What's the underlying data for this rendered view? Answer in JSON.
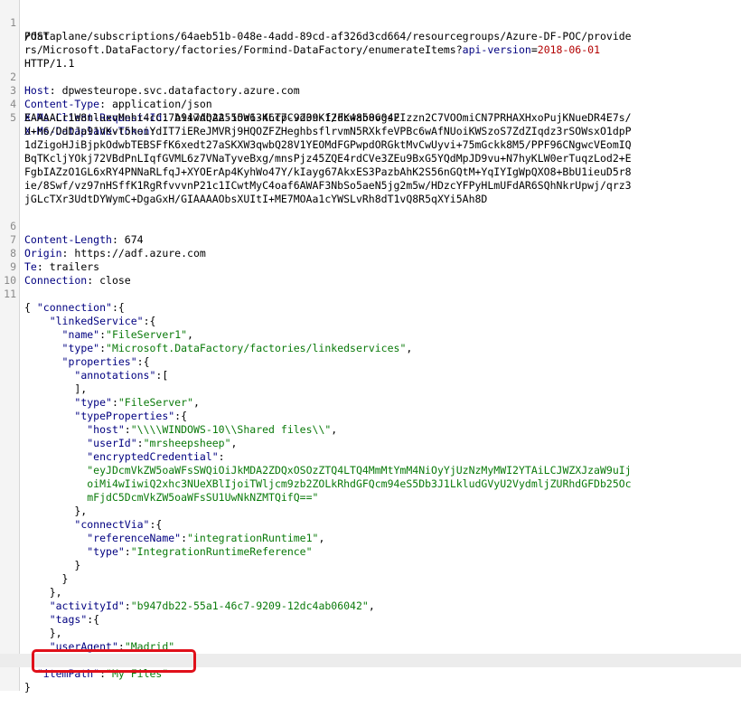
{
  "request": {
    "method": "POST",
    "path_lines": [
      "/dataplane/subscriptions/64aeb51b-048e-4add-89cd-af326d3cd664/resourcegroups/Azure-DF-POC/provide",
      "rs/Microsoft.DataFactory/factories/Formind-DataFactory/enumerateItems?"
    ],
    "query_key": "api-version",
    "query_eq": "=",
    "query_value": "2018-06-01",
    "version": "HTTP/1.1"
  },
  "headers": {
    "host_key": "Host",
    "host_value": "dpwesteurope.svc.datafactory.azure.com",
    "content_type_key": "Content-Type",
    "content_type_value": "application/json",
    "client_request_id_key": "X-Ms-Client-Request-Id",
    "client_request_id_value": "b947db22-55a1-46c7-9209-12dc4ab06042",
    "token_key": "X-Ms-Dataplane-Token",
    "token_lines": [
      "EAAAALr1W8nluxvMnhi4cC17AiiwAQAA51OW63KLTpCvd3nKf/FKw858vgsEIzzn2C7VOOmiCN7PRHAXHxoPujKNueDR4E7s/",
      "U+h6/OdDJa91VKvt5hoiYdIT7iEReJMVRj9HQOZFZHeghbsflrvmN5RXkfeVPBc6wAfNUoiKWSzoS7ZdZIqdz3rSOWsxO1dpP",
      "1dZigoHJiBjpkOdwbTEBSFfK6xedt27aSKXW3qwbQ28V1YEOMdFGPwpdORGktMvCwUyvi+75mGckk8M5/PPF96CNgwcVEomIQ",
      "BqTKcljYOkj72VBdPnLIqfGVML6z7VNaTyveBxg/mnsPjz45ZQE4rdCVe3ZEu9BxG5YQdMpJD9vu+N7hyKLW0erTuqzLod2+E",
      "FgbIAZzO1GL6xRY4PNNaRLfqJ+XYOErAp4KyhWo47Y/kIayg67AkxES3PazbAhK2S56nGQtM+YqIYIgWpQXO8+BbU1ieuD5r8",
      "ie/8Swf/vz97nHSffK1RgRfvvvnP21c1ICwtMyC4oaf6AWAF3NbSo5aeN5jg2m5w/HDzcYFPyHLmUFdAR6SQhNkrUpwj/qrz3",
      "jGLcTXr3UdtDYWymC+DgaGxH/GIAAAAObsXUItI+ME7MOAa1cYWSLvRh8dT1vQ8R5qXYi5Ah8D"
    ],
    "content_length_key": "Content-Length",
    "content_length_value": "674",
    "origin_key": "Origin",
    "origin_value": "https://adf.azure.com",
    "te_key": "Te",
    "te_value": "trailers",
    "connection_key": "Connection",
    "connection_value": "close"
  },
  "body": {
    "k_connection": "\"connection\"",
    "k_linked_service": "\"linkedService\"",
    "k_name": "\"name\"",
    "v_name": "\"FileServer1\"",
    "k_type": "\"type\"",
    "v_type_ls": "\"Microsoft.DataFactory/factories/linkedservices\"",
    "k_properties": "\"properties\"",
    "k_annotations": "\"annotations\"",
    "v_type_fs": "\"FileServer\"",
    "k_type_properties": "\"typeProperties\"",
    "k_host": "\"host\"",
    "v_host": "\"\\\\\\\\WINDOWS-10\\\\Shared files\\\\\"",
    "k_user_id": "\"userId\"",
    "v_user_id": "\"mrsheepsheep\"",
    "k_encrypted": "\"encryptedCredential\"",
    "v_encrypted_lines": [
      "\"eyJDcmVkZW5oaWFsSWQiOiJkMDA2ZDQxOSOzZTQ4LTQ4MmMtYmM4NiOyYjUzNzMyMWI2YTAiLCJWZXJzaW9uIj",
      "oiMi4wIiwiQ2xhc3NUeXBlIjoiTWljcm9zb2ZOLkRhdGFQcm94eS5Db3J1LkludGVyU2VydmljZURhdGFDb25Oc",
      "mFjdC5DcmVkZW5oaWFsSU1UwNkNZMTQifQ==\""
    ],
    "k_connect_via": "\"connectVia\"",
    "k_reference_name": "\"referenceName\"",
    "v_reference_name": "\"integrationRuntime1\"",
    "v_type_irr": "\"IntegrationRuntimeReference\"",
    "k_activity_id": "\"activityId\"",
    "v_activity_id": "\"b947db22-55a1-46c7-9209-12dc4ab06042\"",
    "k_tags": "\"tags\"",
    "k_user_agent": "\"userAgent\"",
    "v_user_agent": "\"Madrid\"",
    "k_item_path": "\"itemPath\"",
    "v_item_path": "\"My Files\""
  },
  "line_numbers": [
    "1",
    "2",
    "3",
    "4",
    "5",
    "6",
    "7",
    "8",
    "9",
    "10",
    "11"
  ],
  "colors": {
    "key": "#000080",
    "string": "#0a7a0a",
    "query_value": "#b30000",
    "callout_border": "#e0101a"
  }
}
